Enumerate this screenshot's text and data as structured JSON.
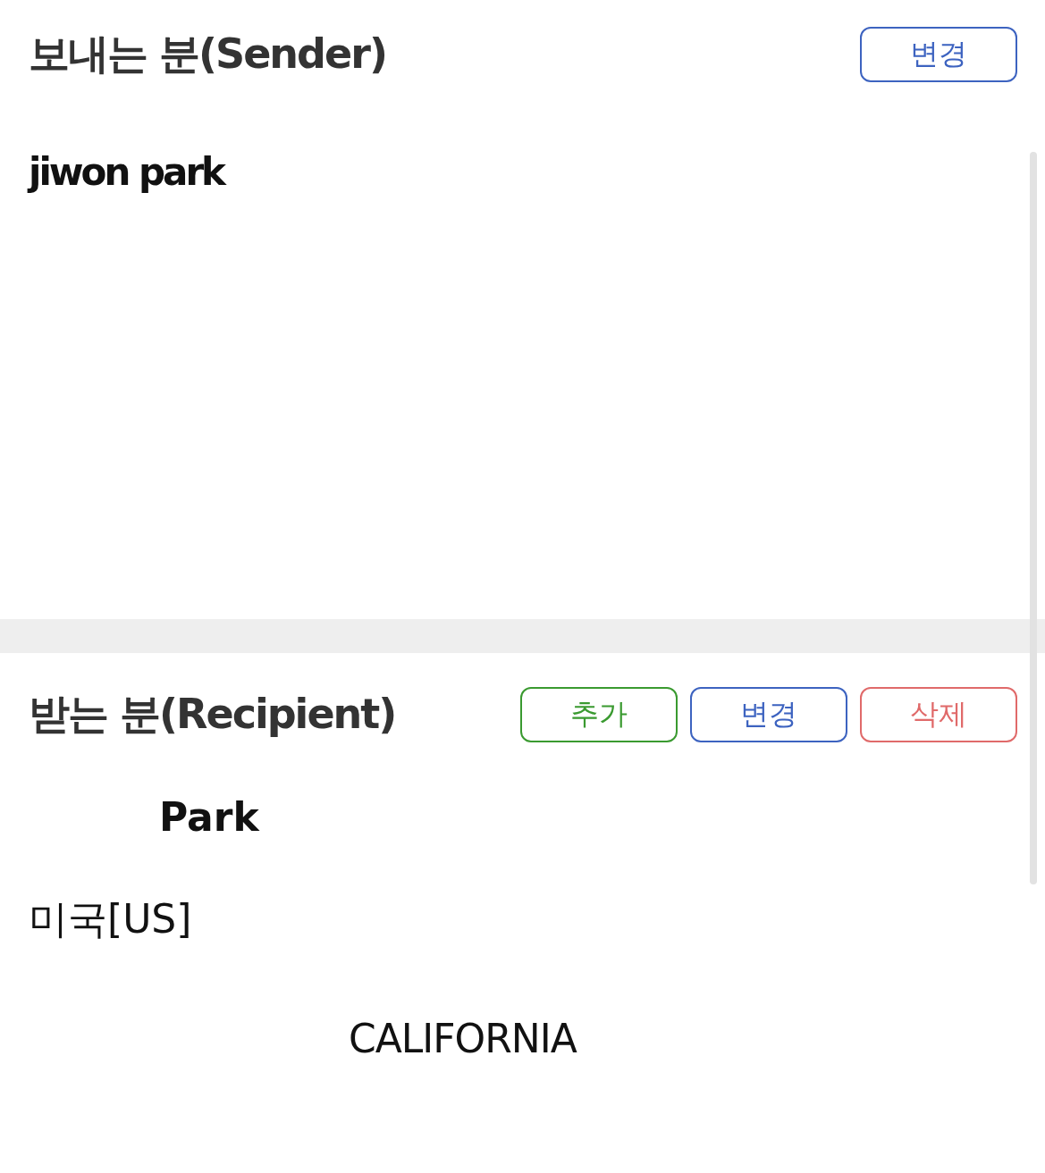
{
  "sender": {
    "title": "보내는 분(Sender)",
    "buttons": [
      {
        "label": "변경",
        "kind": "change"
      }
    ],
    "name": "jiwon park"
  },
  "recipient": {
    "title": "받는 분(Recipient)",
    "buttons": [
      {
        "label": "추가",
        "kind": "add"
      },
      {
        "label": "변경",
        "kind": "change"
      },
      {
        "label": "삭제",
        "kind": "delete"
      }
    ],
    "name": "Park",
    "country": "미국[US]",
    "state": "CALIFORNIA"
  }
}
